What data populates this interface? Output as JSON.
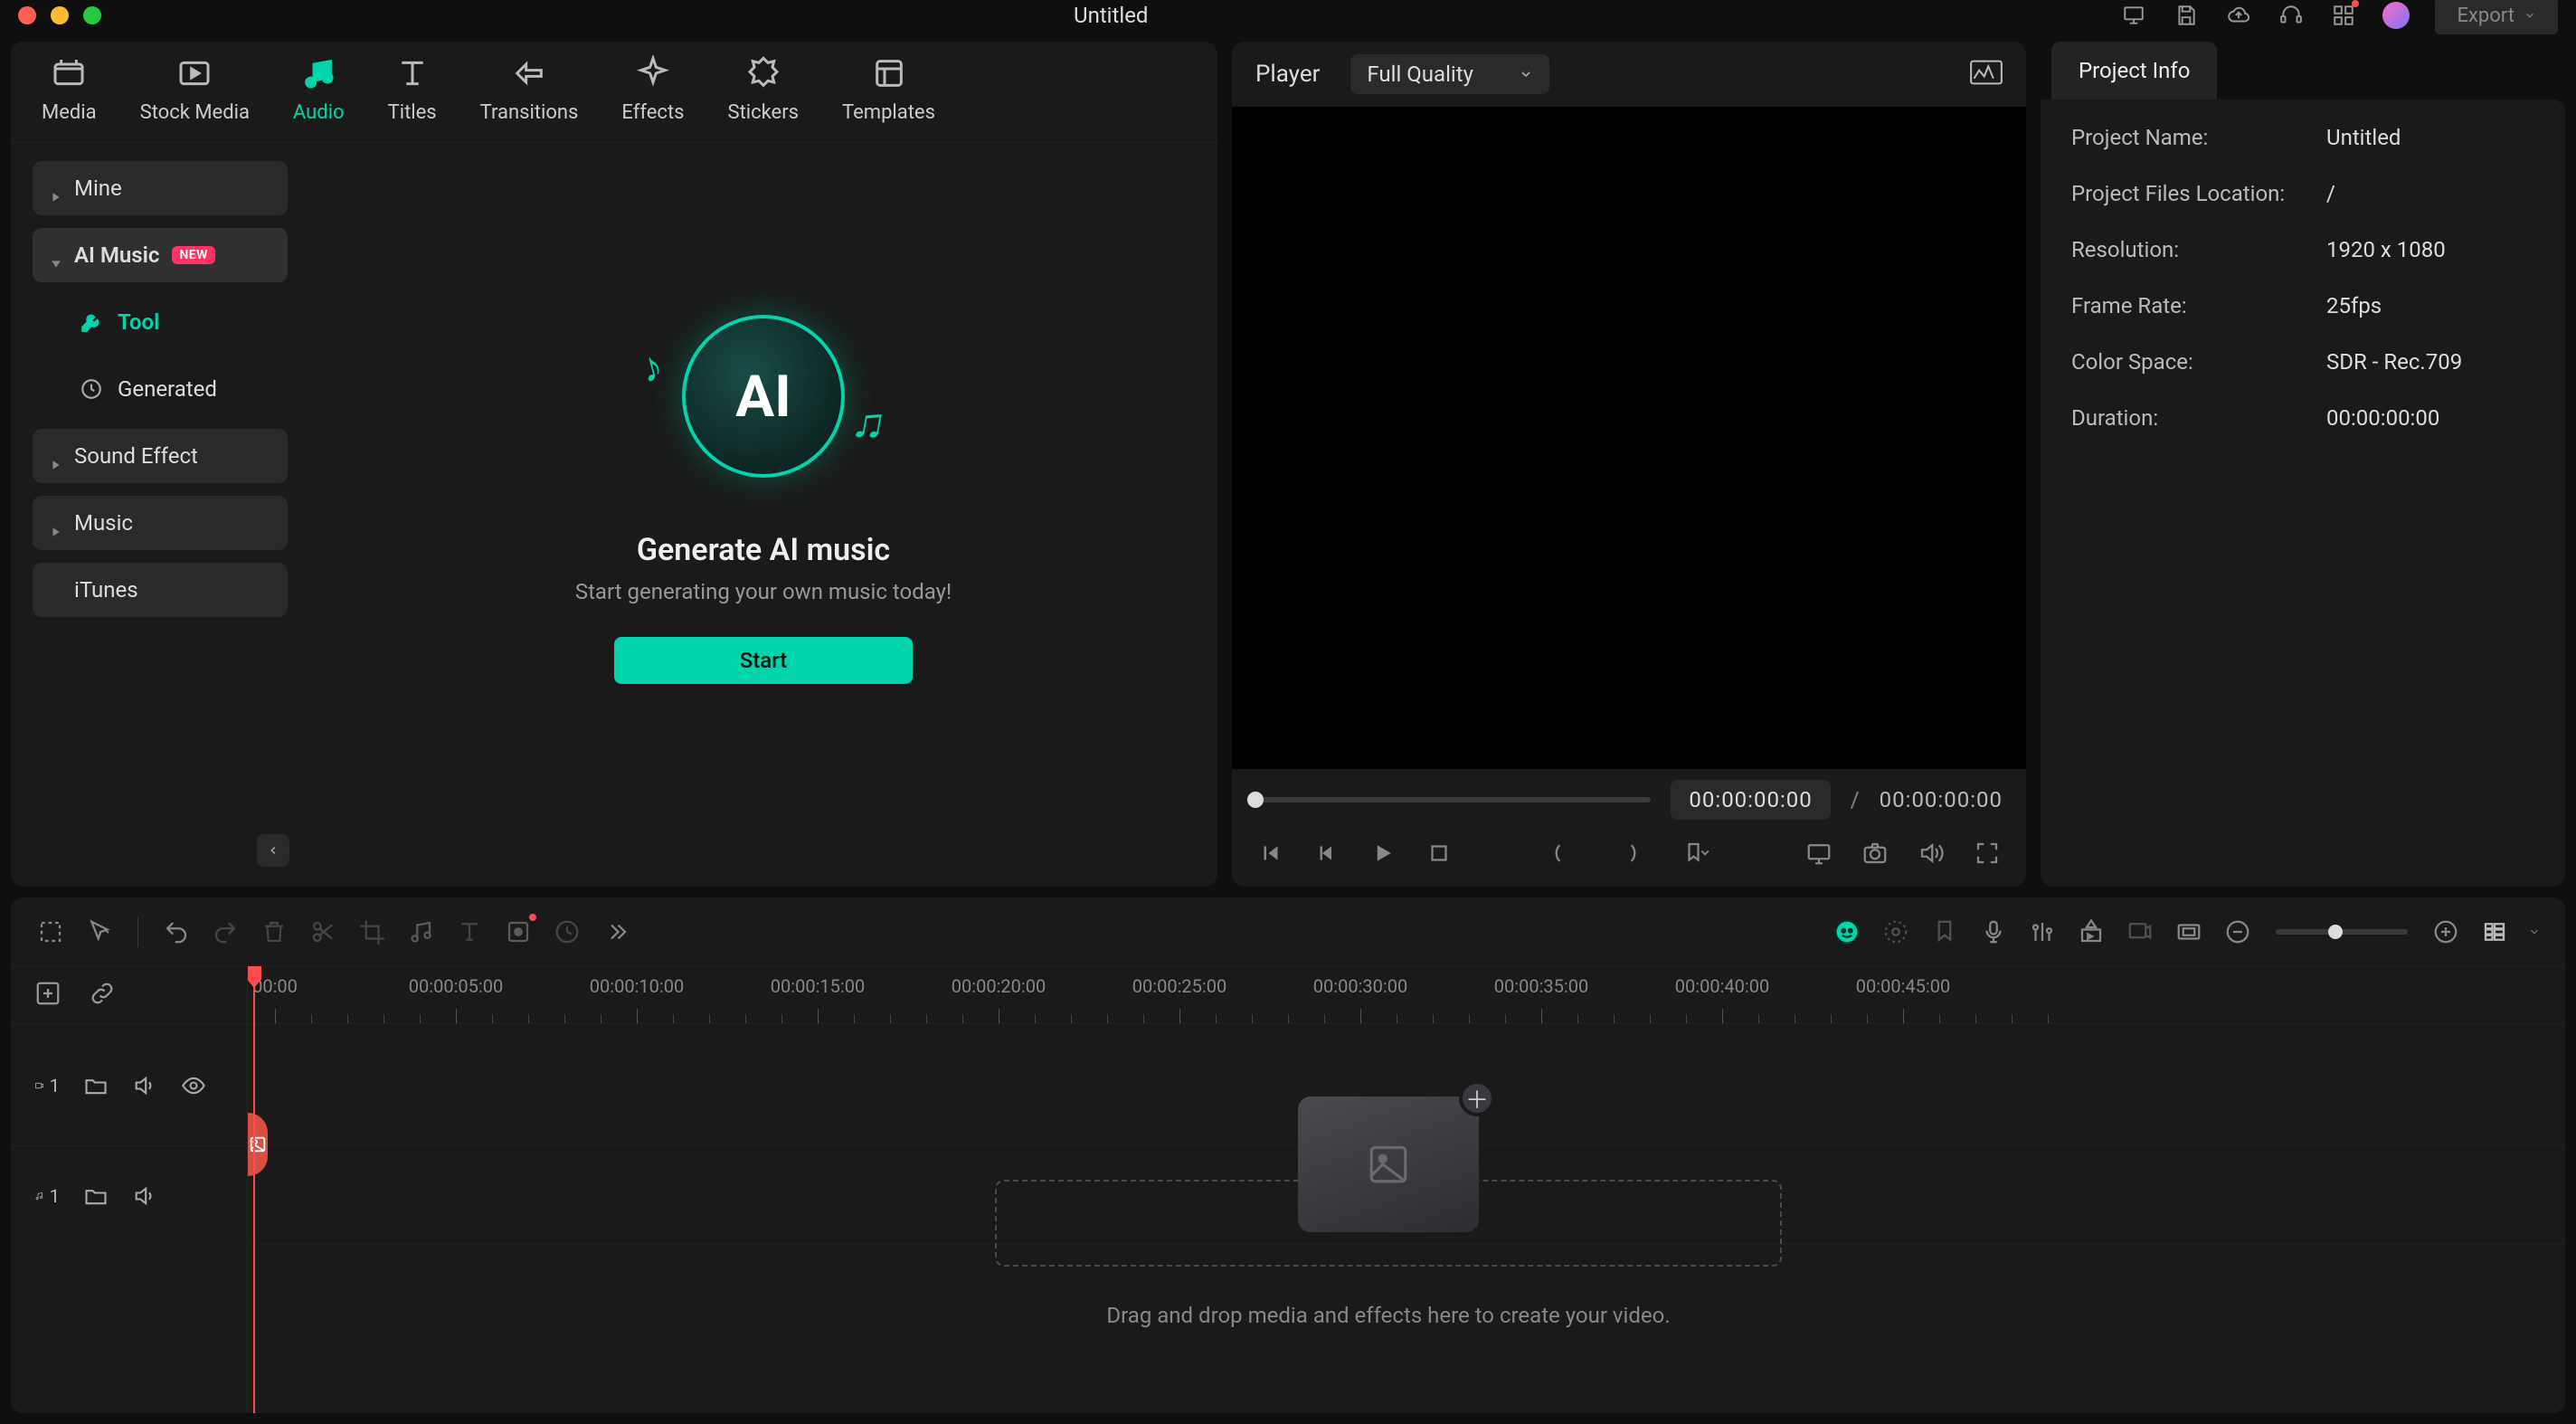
{
  "titlebar": {
    "title": "Untitled",
    "export": "Export"
  },
  "media_tabs": [
    {
      "id": "media",
      "label": "Media"
    },
    {
      "id": "stock",
      "label": "Stock Media"
    },
    {
      "id": "audio",
      "label": "Audio"
    },
    {
      "id": "titles",
      "label": "Titles"
    },
    {
      "id": "transitions",
      "label": "Transitions"
    },
    {
      "id": "effects",
      "label": "Effects"
    },
    {
      "id": "stickers",
      "label": "Stickers"
    },
    {
      "id": "templates",
      "label": "Templates"
    }
  ],
  "media_tabs_active": "audio",
  "audio_sidebar": {
    "mine": "Mine",
    "ai_music": "AI Music",
    "ai_music_badge": "NEW",
    "tool": "Tool",
    "generated": "Generated",
    "sound_effect": "Sound Effect",
    "music": "Music",
    "itunes": "iTunes"
  },
  "ai_panel": {
    "illustration_label": "AI",
    "title": "Generate AI music",
    "subtitle": "Start generating your own music today!",
    "start": "Start"
  },
  "player": {
    "label": "Player",
    "quality": "Full Quality",
    "time_current": "00:00:00:00",
    "time_sep": "/",
    "time_total": "00:00:00:00"
  },
  "inspector": {
    "tab": "Project Info",
    "rows": [
      {
        "k": "Project Name:",
        "v": "Untitled"
      },
      {
        "k": "Project Files Location:",
        "v": "/"
      },
      {
        "k": "Resolution:",
        "v": "1920 x 1080"
      },
      {
        "k": "Frame Rate:",
        "v": "25fps"
      },
      {
        "k": "Color Space:",
        "v": "SDR - Rec.709"
      },
      {
        "k": "Duration:",
        "v": "00:00:00:00"
      }
    ]
  },
  "timeline": {
    "ruler": [
      "00:00",
      "00:00:05:00",
      "00:00:10:00",
      "00:00:15:00",
      "00:00:20:00",
      "00:00:25:00",
      "00:00:30:00",
      "00:00:35:00",
      "00:00:40:00",
      "00:00:45:00"
    ],
    "video_track_index": "1",
    "audio_track_index": "1",
    "drop_hint": "Drag and drop media and effects here to create your video."
  },
  "colors": {
    "accent": "#00d4aa",
    "danger": "#ff4d4d"
  }
}
